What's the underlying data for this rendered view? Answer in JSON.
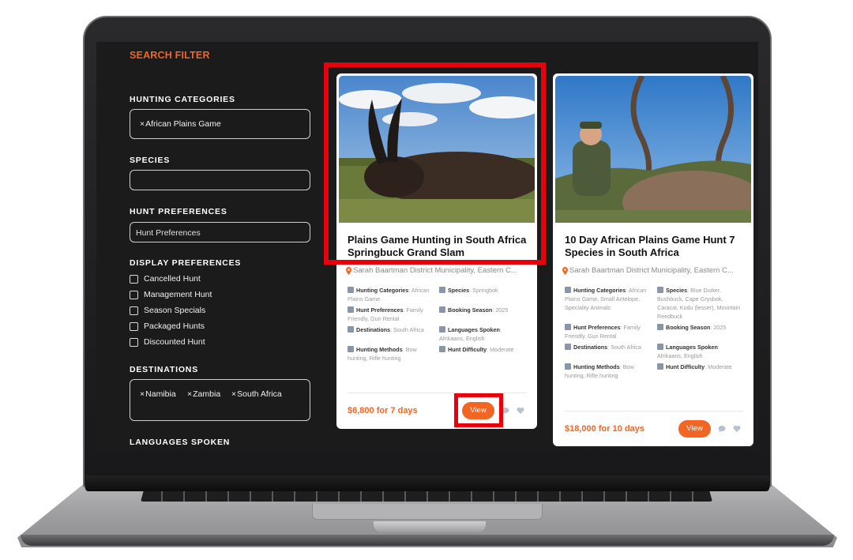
{
  "sidebar": {
    "title": "SEARCH FILTER",
    "hunting_categories": {
      "label": "HUNTING CATEGORIES",
      "tags": [
        "African Plains Game"
      ]
    },
    "species": {
      "label": "SPECIES",
      "value": ""
    },
    "hunt_preferences": {
      "label": "HUNT PREFERENCES",
      "placeholder": "Hunt Preferences"
    },
    "display_preferences": {
      "label": "DISPLAY PREFERENCES",
      "options": [
        "Cancelled Hunt",
        "Management Hunt",
        "Season Specials",
        "Packaged Hunts",
        "Discounted Hunt"
      ]
    },
    "destinations": {
      "label": "DESTINATIONS",
      "tags": [
        "Namibia",
        "Zambia",
        "South Africa"
      ]
    },
    "languages": {
      "label": "LANGUAGES SPOKEN"
    }
  },
  "tag_remove_glyph": "×",
  "cards": [
    {
      "title_line1": "Plains Game Hunting in South Africa",
      "title_line2": "Springbuck Grand Slam",
      "location": "Sarah Baartman District Municipality, Eastern C...",
      "meta": {
        "hunting_categories": {
          "k": "Hunting Categories",
          "v": "African Plains Game"
        },
        "species": {
          "k": "Species",
          "v": "Springbok"
        },
        "hunt_preferences": {
          "k": "Hunt Preferences",
          "v": "Family Friendly, Gun Rental"
        },
        "booking_season": {
          "k": "Booking Season",
          "v": "2025"
        },
        "destinations": {
          "k": "Destinations",
          "v": "South Africa"
        },
        "languages": {
          "k": "Languages Spoken",
          "v": "Afrikaans, English"
        },
        "hunting_methods": {
          "k": "Hunting Methods",
          "v": "Bow hunting, Rifle hunting"
        },
        "difficulty": {
          "k": "Hunt Difficulty",
          "v": "Moderate"
        }
      },
      "price": "$6,800 for 7 days",
      "view_label": "View"
    },
    {
      "title_line1": "10 Day African Plains Game Hunt 7",
      "title_line2": "Species in South Africa",
      "location": "Sarah Baartman District Municipality, Eastern C...",
      "meta": {
        "hunting_categories": {
          "k": "Hunting Categories",
          "v": "African Plains Game, Small Antelope, Speciality Animals"
        },
        "species": {
          "k": "Species",
          "v": "Blue Duiker, Bushbuck, Cape Grysbok, Caracal, Kudu (lesser), Mountain Reedbuck"
        },
        "hunt_preferences": {
          "k": "Hunt Preferences",
          "v": "Family Friendly, Gun Rental"
        },
        "booking_season": {
          "k": "Booking Season",
          "v": "2025"
        },
        "destinations": {
          "k": "Destinations",
          "v": "South Africa"
        },
        "languages": {
          "k": "Languages Spoken",
          "v": "Afrikaans, English"
        },
        "hunting_methods": {
          "k": "Hunting Methods",
          "v": "Bow hunting, Rifle hunting"
        },
        "difficulty": {
          "k": "Hunt Difficulty",
          "v": "Moderate"
        }
      },
      "price": "$18,000 for 10 days",
      "view_label": "View"
    }
  ],
  "colors": {
    "accent": "#f26522",
    "highlight": "#e8000b",
    "screen_bg": "#1b1b1b"
  }
}
